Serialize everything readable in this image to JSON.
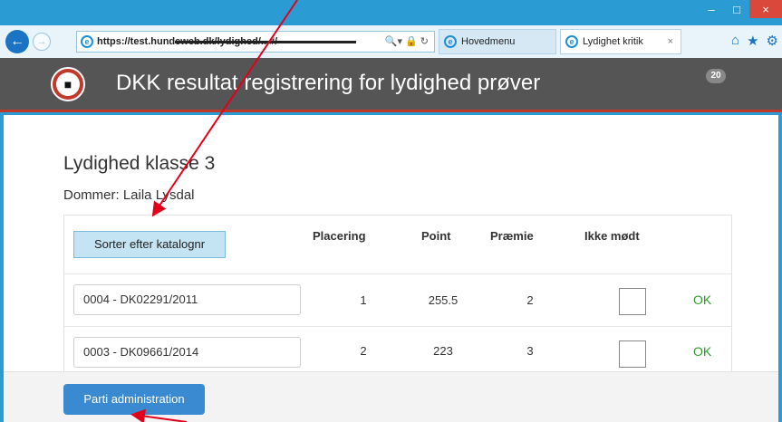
{
  "browser": {
    "address_url": "https://test.hundeweb.dk/lydighed/...#/",
    "tabs": [
      {
        "label": "Hovedmenu"
      },
      {
        "label": "Lydighet kritik"
      }
    ],
    "tab_close_glyph": "×",
    "window_controls": {
      "minimize": "–",
      "maximize": "□",
      "close": "×"
    },
    "nav_icons": [
      "home-icon",
      "star-icon",
      "gear-icon"
    ]
  },
  "header": {
    "title": "DKK resultat registrering for lydighed prøver",
    "badge_count": "20",
    "accent_color": "#c0392b",
    "bar_color": "#555555"
  },
  "main": {
    "class_title": "Lydighed klasse 3",
    "judge": "Dommer: Laila Lysdal",
    "sort_button": "Sorter efter katalognr",
    "columns": {
      "placement": "Placering",
      "points": "Point",
      "prize": "Præmie",
      "absent": "Ikke mødt"
    },
    "rows": [
      {
        "entry": "0004 - DK02291/2011",
        "placement": "1",
        "points": "255.5",
        "prize": "2",
        "absent": false,
        "status": "OK"
      },
      {
        "entry": "0003 - DK09661/2014",
        "placement": "2",
        "points": "223",
        "prize": "3",
        "absent": false,
        "status": "OK"
      }
    ],
    "status_color": "#2e9c2e"
  },
  "footer": {
    "admin_button": "Parti administration",
    "button_color": "#3a8ad1"
  }
}
